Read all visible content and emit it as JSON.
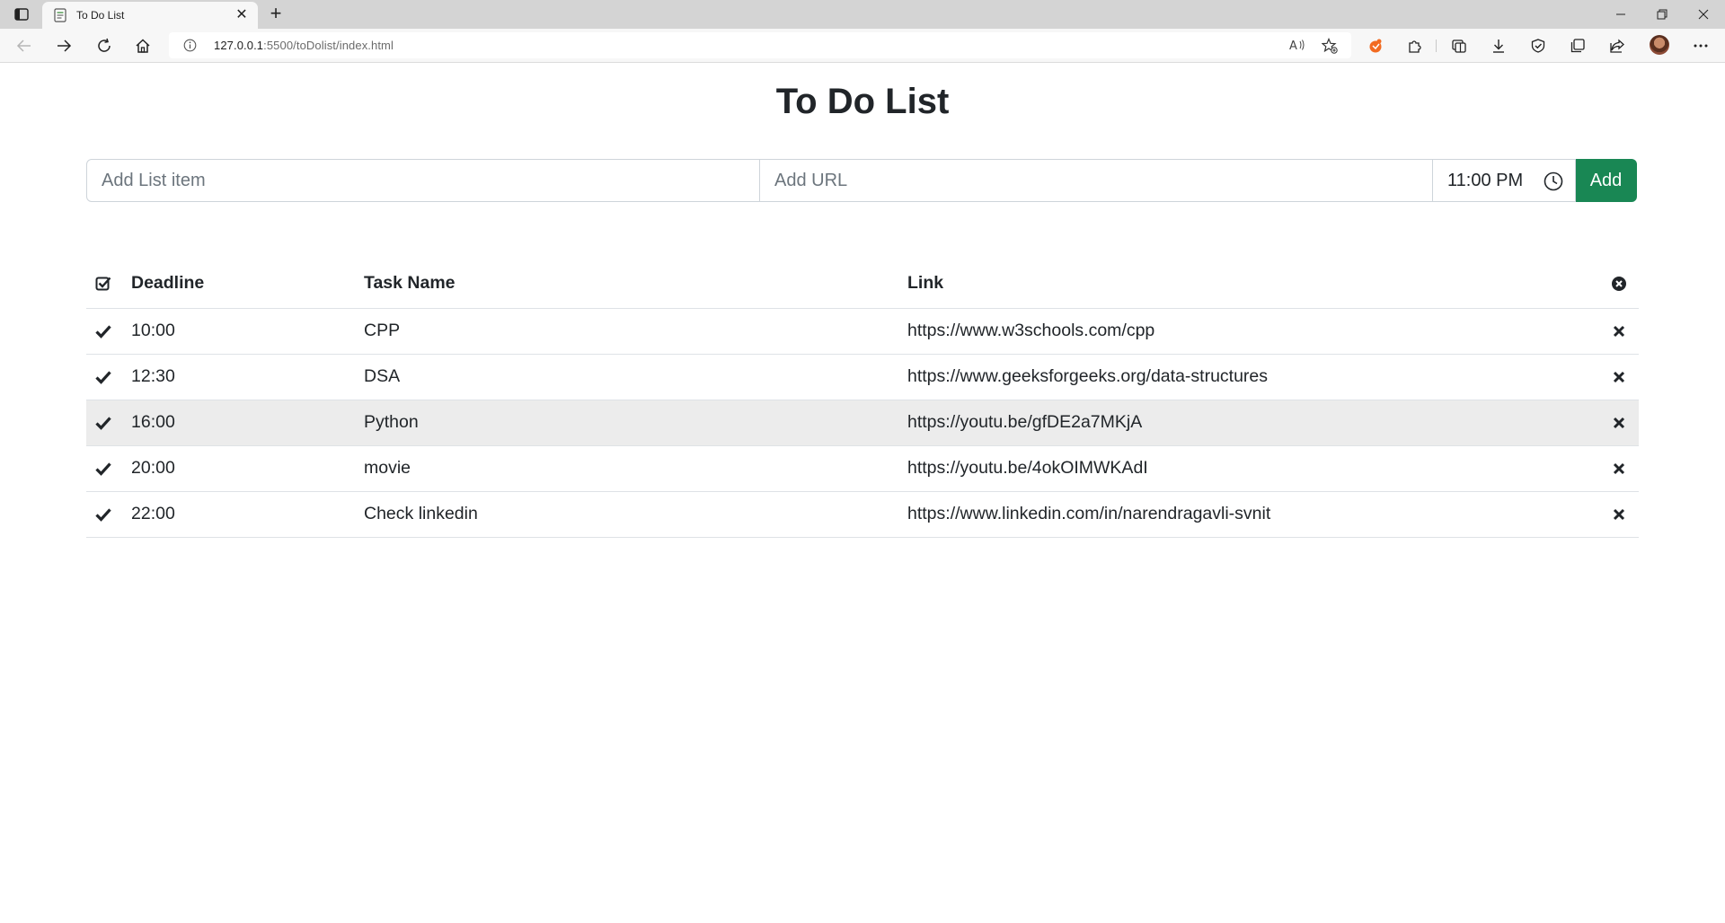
{
  "browser": {
    "tab_title": "To Do List",
    "url_host": "127.0.0.1",
    "url_rest": ":5500/toDolist/index.html"
  },
  "page": {
    "title": "To Do List",
    "item_placeholder": "Add List item",
    "url_placeholder": "Add URL",
    "time_value": "11:00 PM",
    "add_label": "Add"
  },
  "table": {
    "headers": {
      "deadline": "Deadline",
      "task": "Task Name",
      "link": "Link"
    },
    "rows": [
      {
        "deadline": "10:00",
        "task": "CPP",
        "link": "https://www.w3schools.com/cpp",
        "highlighted": false
      },
      {
        "deadline": "12:30",
        "task": "DSA",
        "link": "https://www.geeksforgeeks.org/data-structures",
        "highlighted": false
      },
      {
        "deadline": "16:00",
        "task": "Python",
        "link": "https://youtu.be/gfDE2a7MKjA",
        "highlighted": true
      },
      {
        "deadline": "20:00",
        "task": "movie",
        "link": "https://youtu.be/4okOIMWKAdI",
        "highlighted": false
      },
      {
        "deadline": "22:00",
        "task": "Check linkedin",
        "link": "https://www.linkedin.com/in/narendragavli-svnit",
        "highlighted": false
      }
    ]
  },
  "colors": {
    "accent": "#198754",
    "row_highlight": "#ececec",
    "text": "#212529"
  }
}
